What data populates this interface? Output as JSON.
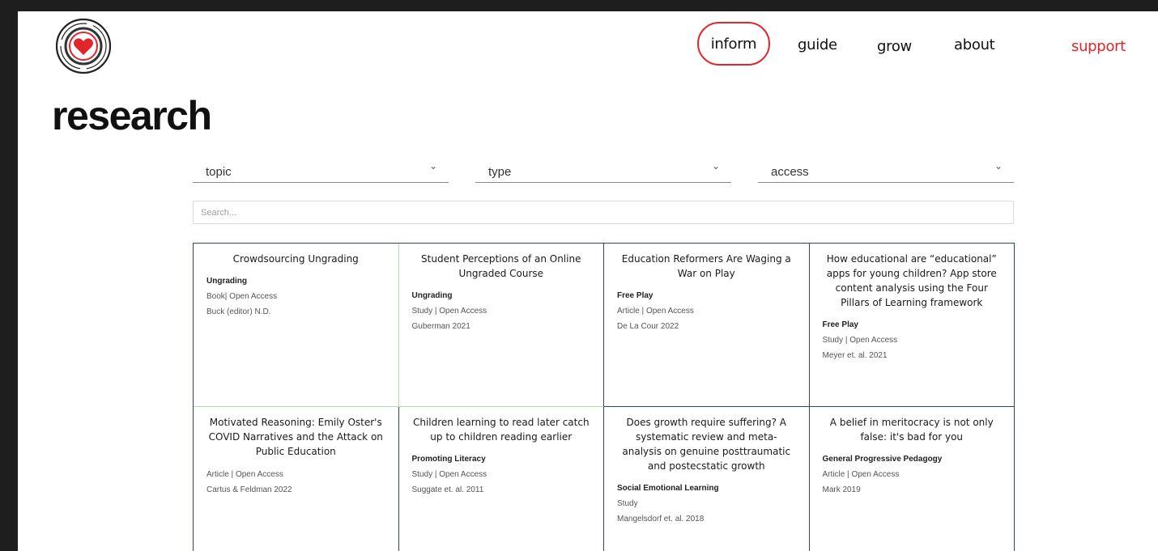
{
  "nav": {
    "items": [
      "inform",
      "guide",
      "grow",
      "about"
    ],
    "support": "support",
    "active": "inform",
    "accent": "#e0262b"
  },
  "page": {
    "title": "research"
  },
  "filters": {
    "topic": "topic",
    "type": "type",
    "access": "access"
  },
  "search": {
    "placeholder": "Search..."
  },
  "cards": [
    {
      "title": "Crowdsourcing Ungrading",
      "topic": "Ungrading",
      "meta1": "Book| Open Access",
      "meta2": "Buck (editor) N.D."
    },
    {
      "title": "Student Perceptions of an Online Ungraded Course",
      "topic": "Ungrading",
      "meta1": "Study | Open Access",
      "meta2": "Guberman 2021"
    },
    {
      "title": "Education Reformers Are Waging a War on Play",
      "topic": "Free Play",
      "meta1": "Article | Open Access",
      "meta2": "De La Cour 2022"
    },
    {
      "title": "How educational are “educational” apps for young children? App store content analysis using the Four Pillars of Learning framework",
      "topic": "Free Play",
      "meta1": "Study | Open Access",
      "meta2": "Meyer et. al. 2021"
    },
    {
      "title": "Motivated Reasoning: Emily Oster's COVID Narratives and the Attack on Public Education",
      "topic": "",
      "meta1": "Article | Open Access",
      "meta2": "Cartus & Feldman 2022"
    },
    {
      "title": "Children learning to read later catch up to children reading earlier",
      "topic": "Promoting Literacy",
      "meta1": "Study | Open Access",
      "meta2": "Suggate et. al. 2011"
    },
    {
      "title": "Does growth require suffering? A systematic review and meta-analysis on genuine posttraumatic and postecstatic growth",
      "topic": "Social Emotional Learning",
      "meta1": "Study",
      "meta2": "Mangelsdorf et. al. 2018"
    },
    {
      "title": "A belief in meritocracy is not only false: it's bad for you",
      "topic": "General Progressive Pedagogy",
      "meta1": "Article | Open Access",
      "meta2": "Mark 2019"
    }
  ]
}
